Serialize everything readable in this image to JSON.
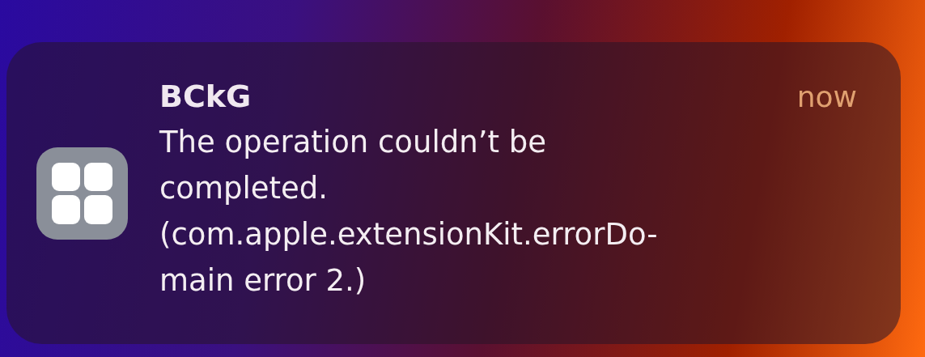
{
  "notification": {
    "app_name": "BCkG",
    "time": "now",
    "message_lines": [
      "The operation couldn’t be",
      "completed.",
      "(com.apple.extensionKit.errorDo-",
      "main error 2.)"
    ]
  }
}
